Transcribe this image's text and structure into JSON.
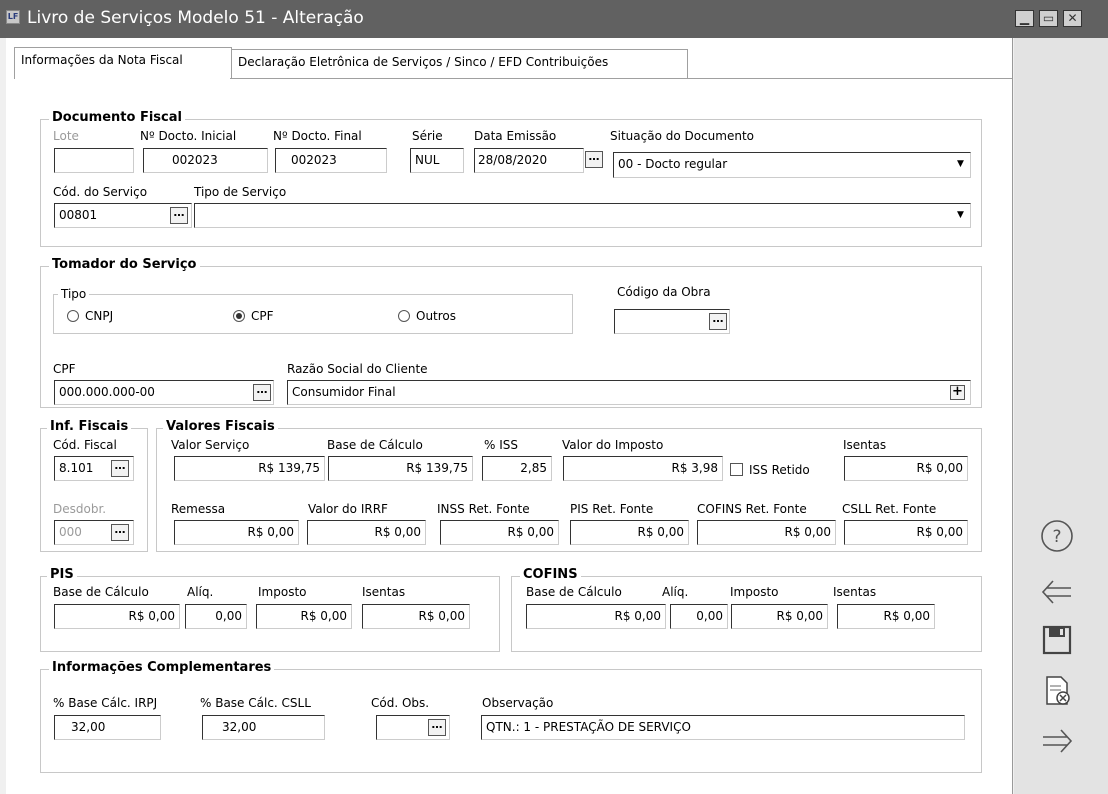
{
  "window": {
    "app_icon": "LF",
    "title": "Livro de Serviços Modelo 51 - Alteração"
  },
  "tabs": [
    "Informações da Nota Fiscal",
    "Declaração Eletrônica de Serviços / Sinco / EFD Contribuições"
  ],
  "doc": {
    "title": "Documento Fiscal",
    "lote_label": "Lote",
    "lote": "",
    "ini_label": "Nº Docto. Inicial",
    "ini": "002023",
    "fin_label": "Nº Docto. Final",
    "fin": "002023",
    "serie_label": "Série",
    "serie": "NUL",
    "data_label": "Data Emissão",
    "data": "28/08/2020",
    "sit_label": "Situação do Documento",
    "sit": "00 - Docto regular",
    "cod_label": "Cód. do Serviço",
    "cod": "00801",
    "tipo_label": "Tipo de Serviço",
    "tipo": ""
  },
  "tomador": {
    "title": "Tomador do Serviço",
    "tipo_title": "Tipo",
    "opt1": "CNPJ",
    "opt2": "CPF",
    "opt3": "Outros",
    "obra_label": "Código da Obra",
    "obra": "",
    "cpf_label": "CPF",
    "cpf": "000.000.000-00",
    "razao_label": "Razão Social do Cliente",
    "razao": "Consumidor Final"
  },
  "inf": {
    "title": "Inf. Fiscais",
    "cod_label": "Cód. Fiscal",
    "cod": "8.101",
    "desd_label": "Desdobr.",
    "desd": "000"
  },
  "val": {
    "title": "Valores Fiscais",
    "vs_label": "Valor Serviço",
    "vs": "R$ 139,75",
    "bc_label": "Base de Cálculo",
    "bc": "R$ 139,75",
    "iss_label": "% ISS",
    "iss": "2,85",
    "vi_label": "Valor do Imposto",
    "vi": "R$ 3,98",
    "retido_label": "ISS Retido",
    "is_label": "Isentas",
    "is": "R$ 0,00",
    "rem_label": "Remessa",
    "rem": "R$ 0,00",
    "irrf_label": "Valor do IRRF",
    "irrf": "R$ 0,00",
    "inss_label": "INSS Ret. Fonte",
    "inss": "R$ 0,00",
    "pis_label": "PIS Ret. Fonte",
    "pis": "R$ 0,00",
    "cof_label": "COFINS Ret. Fonte",
    "cof": "R$ 0,00",
    "csll_label": "CSLL Ret. Fonte",
    "csll": "R$ 0,00"
  },
  "pis": {
    "title": "PIS",
    "bc_label": "Base de Cálculo",
    "bc": "R$ 0,00",
    "aliq_label": "Alíq.",
    "aliq": "0,00",
    "imp_label": "Imposto",
    "imp": "R$ 0,00",
    "is_label": "Isentas",
    "is": "R$ 0,00"
  },
  "cofins": {
    "title": "COFINS",
    "bc_label": "Base de Cálculo",
    "bc": "R$ 0,00",
    "aliq_label": "Alíq.",
    "aliq": "0,00",
    "imp_label": "Imposto",
    "imp": "R$ 0,00",
    "is_label": "Isentas",
    "is": "R$ 0,00"
  },
  "comp": {
    "title": "Informações Complementares",
    "irpj_label": "% Base Cálc. IRPJ",
    "irpj": "32,00",
    "csll_label": "% Base Cálc. CSLL",
    "csll": "32,00",
    "obs_cod_label": "Cód. Obs.",
    "obs_cod": "",
    "obs_label": "Observação",
    "obs": "QTN.: 1 - PRESTAÇÃO DE SERVIÇO"
  },
  "side_buttons": [
    "help-icon",
    "back-arrow-icon",
    "save-icon",
    "cancel-document-icon",
    "forward-arrow-icon"
  ]
}
